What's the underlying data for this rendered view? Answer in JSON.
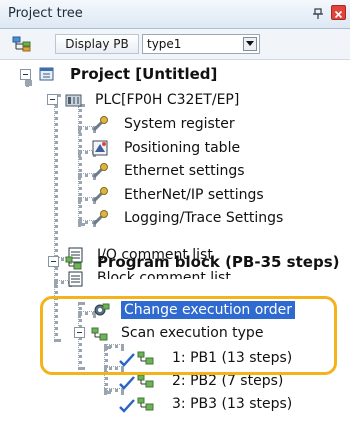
{
  "panel": {
    "title": "Project tree"
  },
  "toolbar": {
    "display_pb_label": "Display PB",
    "type_value": "type1"
  },
  "tree": {
    "project": "Project [Untitled]",
    "plc": "PLC[FP0H C32ET/EP]",
    "system_register": "System register",
    "positioning_table": "Positioning table",
    "ethernet_settings": "Ethernet settings",
    "ethernetip_settings": "EtherNet/IP settings",
    "logging_trace": "Logging/Trace Settings",
    "io_comment": "I/O comment list",
    "block_comment": "Block comment list",
    "program_block": "Program block (PB-35 steps)",
    "change_exec_order": "Change execution order",
    "scan_exec_type": "Scan execution type",
    "pb1": "1: PB1 (13 steps)",
    "pb2": "2: PB2 (7 steps)",
    "pb3": "3: PB3 (13 steps)"
  },
  "colors": {
    "highlight": "#f2b31b",
    "selection": "#2f6ad0"
  },
  "icons": {
    "pin": "pin-icon",
    "close": "close-icon",
    "toolbar": "tree-view-icon",
    "project": "project-icon",
    "plc": "plc-icon",
    "settings": "wrench-icon",
    "positioning": "positioning-icon",
    "comment": "comment-list-icon",
    "program_block": "program-block-icon",
    "checkmark": "checkmark-icon"
  }
}
